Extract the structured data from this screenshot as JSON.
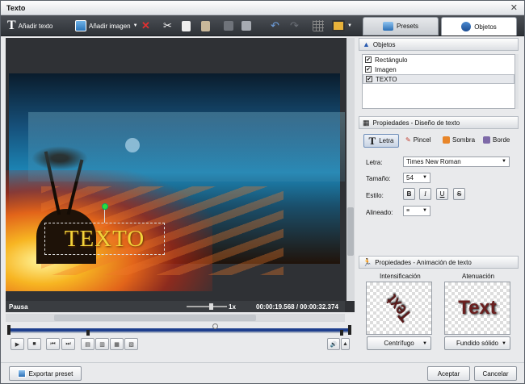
{
  "window": {
    "title": "Texto",
    "close_glyph": "✕"
  },
  "toolbar": {
    "add_text": "Añadir texto",
    "add_image": "Añadir imagen",
    "tabs": [
      {
        "label": "Presets"
      },
      {
        "label": "Objetos"
      }
    ],
    "active_tab": "Objetos"
  },
  "canvas": {
    "text_object": "TEXTO"
  },
  "player": {
    "state": "Pausa",
    "speed": "1x",
    "time_current": "00:00:19.568",
    "time_separator": "/",
    "time_total": "00:00:32.374"
  },
  "objects": {
    "header": "Objetos",
    "items": [
      {
        "label": "Rectángulo",
        "checked": true
      },
      {
        "label": "Imagen",
        "checked": true
      },
      {
        "label": "TEXTO",
        "checked": true
      }
    ],
    "selected": "TEXTO"
  },
  "text_design": {
    "header": "Propiedades - Diseño de texto",
    "tabs": [
      "Letra",
      "Pincel",
      "Sombra",
      "Borde"
    ],
    "active_tab": "Letra",
    "font_label": "Letra:",
    "font_value": "Times New Roman",
    "size_label": "Tamaño:",
    "size_value": "54",
    "style_label": "Estilo:",
    "style_buttons": [
      "B",
      "I",
      "U",
      "S"
    ],
    "align_label": "Alineado:",
    "align_icon": "align-center-icon"
  },
  "text_animation": {
    "header": "Propiedades - Animación de texto",
    "in_label": "Intensificación",
    "out_label": "Atenuación",
    "in_preview": "Text",
    "out_preview": "Text",
    "in_effect": "Centrífugo",
    "out_effect": "Fundido sólido"
  },
  "footer": {
    "export": "Exportar preset",
    "ok": "Aceptar",
    "cancel": "Cancelar"
  },
  "colors": {
    "accent": "#1e3f8e",
    "text_fill": "#f2d23a",
    "toolbar": "#3a3d41"
  }
}
